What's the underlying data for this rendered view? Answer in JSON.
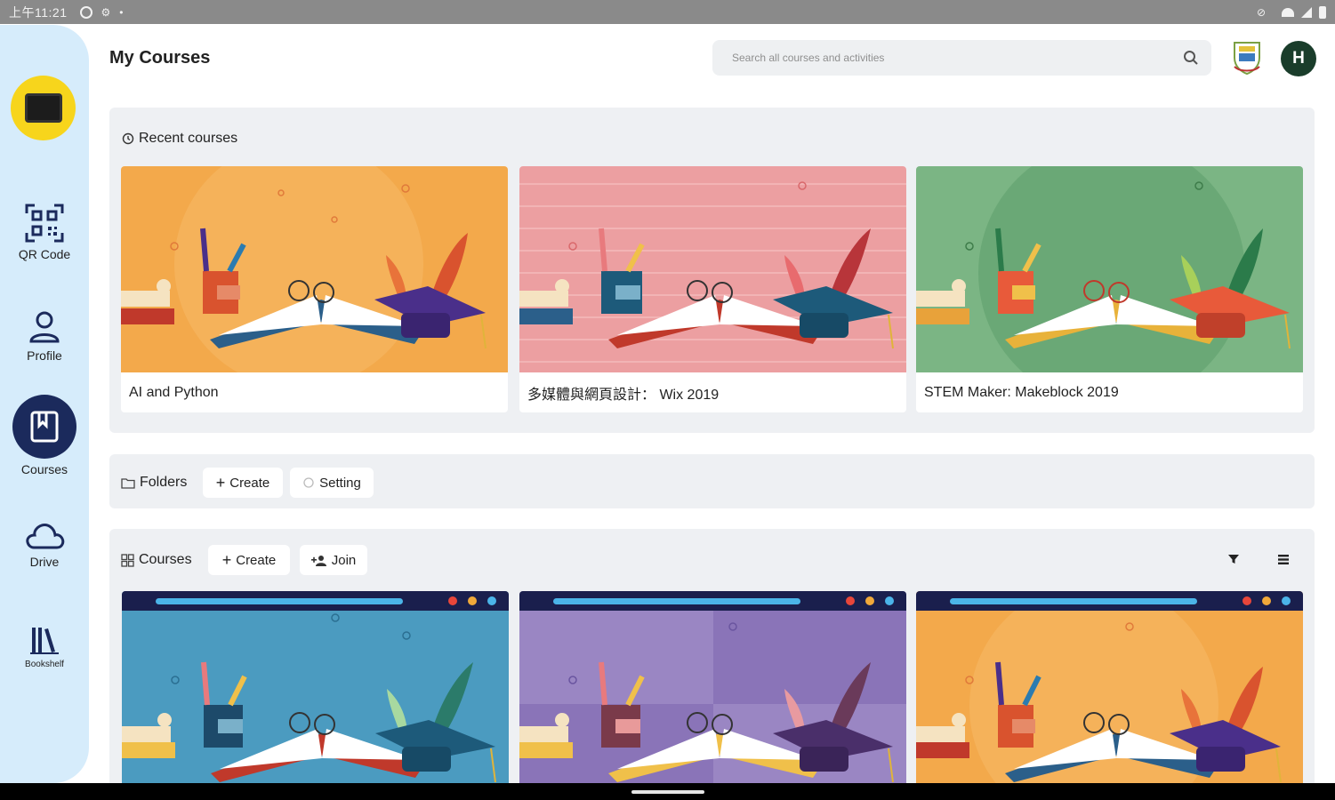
{
  "statusbar": {
    "time": "上午11:21"
  },
  "sidebar": {
    "items": [
      {
        "label": "QR Code",
        "icon": "qr-code-icon"
      },
      {
        "label": "Profile",
        "icon": "person-icon"
      },
      {
        "label": "Courses",
        "icon": "book-icon",
        "active": true
      },
      {
        "label": "Drive",
        "icon": "cloud-icon"
      },
      {
        "label": "Bookshelf",
        "icon": "bookshelf-icon"
      }
    ]
  },
  "header": {
    "title": "My Courses",
    "search_placeholder": "Search all courses and activities",
    "avatar_initial": "H"
  },
  "recent": {
    "heading": "Recent courses",
    "cards": [
      {
        "title": "AI and Python",
        "bg": "#f3a94b"
      },
      {
        "title": "多媒體與網頁設計： Wix 2019",
        "bg": "#ec9fa1"
      },
      {
        "title": "STEM Maker: Makeblock 2019",
        "bg": "#7bb584"
      }
    ]
  },
  "folders": {
    "heading": "Folders",
    "create_label": "Create",
    "setting_label": "Setting"
  },
  "courses": {
    "heading": "Courses",
    "create_label": "Create",
    "join_label": "Join",
    "cards": [
      {
        "bg": "#4b9bc0"
      },
      {
        "bg": "#9a86c3"
      },
      {
        "bg": "#f3a94b"
      }
    ]
  },
  "colors": {
    "sidebar_bg": "#d6ecfb",
    "logo_yellow": "#f7d51c",
    "active_nav": "#1b2a5c",
    "avatar_bg": "#1a3d2b"
  }
}
